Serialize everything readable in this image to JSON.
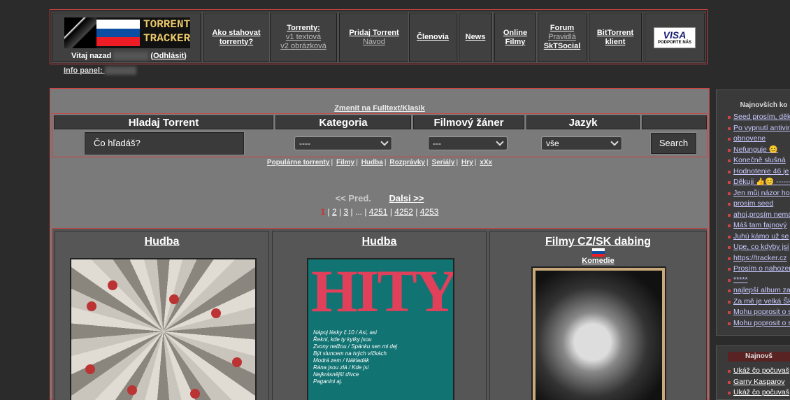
{
  "header": {
    "logo_text": "TORRENT\nTRACKER",
    "welcome_prefix": "Vitaj nazad",
    "logout": "Odhlásit",
    "nav": [
      {
        "main": "Ako stahovat torrenty?",
        "sub": ""
      },
      {
        "main": "Torrenty:",
        "sub": "v1 textová",
        "sub2": "v2 obrázková"
      },
      {
        "main": "Pridaj Torrent",
        "sub": "Návod"
      },
      {
        "main": "Členovia"
      },
      {
        "main": "News"
      },
      {
        "main": "Online Filmy"
      },
      {
        "main": "Forum",
        "sub": "Pravidlá",
        "sub3": "SkTSocial"
      },
      {
        "main": "BitTorrent klient"
      }
    ],
    "visa": {
      "brand": "VISA",
      "slogan": "PODPORTE NÁS"
    },
    "info_panel": "Info panel:"
  },
  "search": {
    "switch": "Zmenit na Fulltext/Klasik",
    "headers": [
      "Hladaj Torrent",
      "Kategoria",
      "Filmový žáner",
      "Jazyk"
    ],
    "query_placeholder": "Čo hľadáš?",
    "kategoria": "----",
    "zaner": "---",
    "jazyk": "vše",
    "button": "Search"
  },
  "categories": [
    "Populárne torrenty",
    "Filmy",
    "Hudba",
    "Rozprávky",
    "Seriály",
    "Hry",
    "xXx"
  ],
  "pager": {
    "prev": "<< Pred.",
    "next": "Dalsi >>",
    "current": "1",
    "p2": "2",
    "p3": "3",
    "ellipsis": "...",
    "p4251": "4251",
    "p4252": "4252",
    "p4253": "4253"
  },
  "torrents": [
    {
      "category": "Hudba"
    },
    {
      "category": "Hudba",
      "poster_title": "HITY",
      "tracks": [
        "Nápoj lásky č.10 / Asi, asi",
        "Řekni, kde ty kytky jsou",
        "Zvony nelžou / Spánku sen mi dej",
        "Být sluncem na tvých víčkách",
        "Modrá zem / Nákladák",
        "Rána jsou zlá / Kde jsi",
        "Nejkrásnější dívce",
        "Paganini aj."
      ]
    },
    {
      "category": "Filmy CZ/SK dabing",
      "genre": "Komedie"
    }
  ],
  "sidebar": {
    "title": "Najnovších ko",
    "comments": [
      "Seed prosím, děku",
      "Po vypnutí antiviru",
      "obnovene",
      "Nefunguje 😊",
      "Konečně slušná",
      "Hodnotenie 46 je",
      "Děkuji 👍😊 --------",
      "Jen můj názor ho",
      "prosim seed",
      "ahoj,prosím nemá",
      "Máš tam fajnový",
      "Juhú kámo už se",
      "Upe, co kdyby jsi",
      "https://tracker.cz",
      "Prosím o nahozen",
      "*****",
      "najlepší album za",
      "Za mě je velká Šk",
      "Mohu poprosit o s",
      "Mohu poprosit o s"
    ],
    "title2": "Najnovš",
    "latest": [
      "Ukáž čo počuvaš",
      "Garry Kasparov",
      "Ukáž čo počuvaš"
    ]
  }
}
